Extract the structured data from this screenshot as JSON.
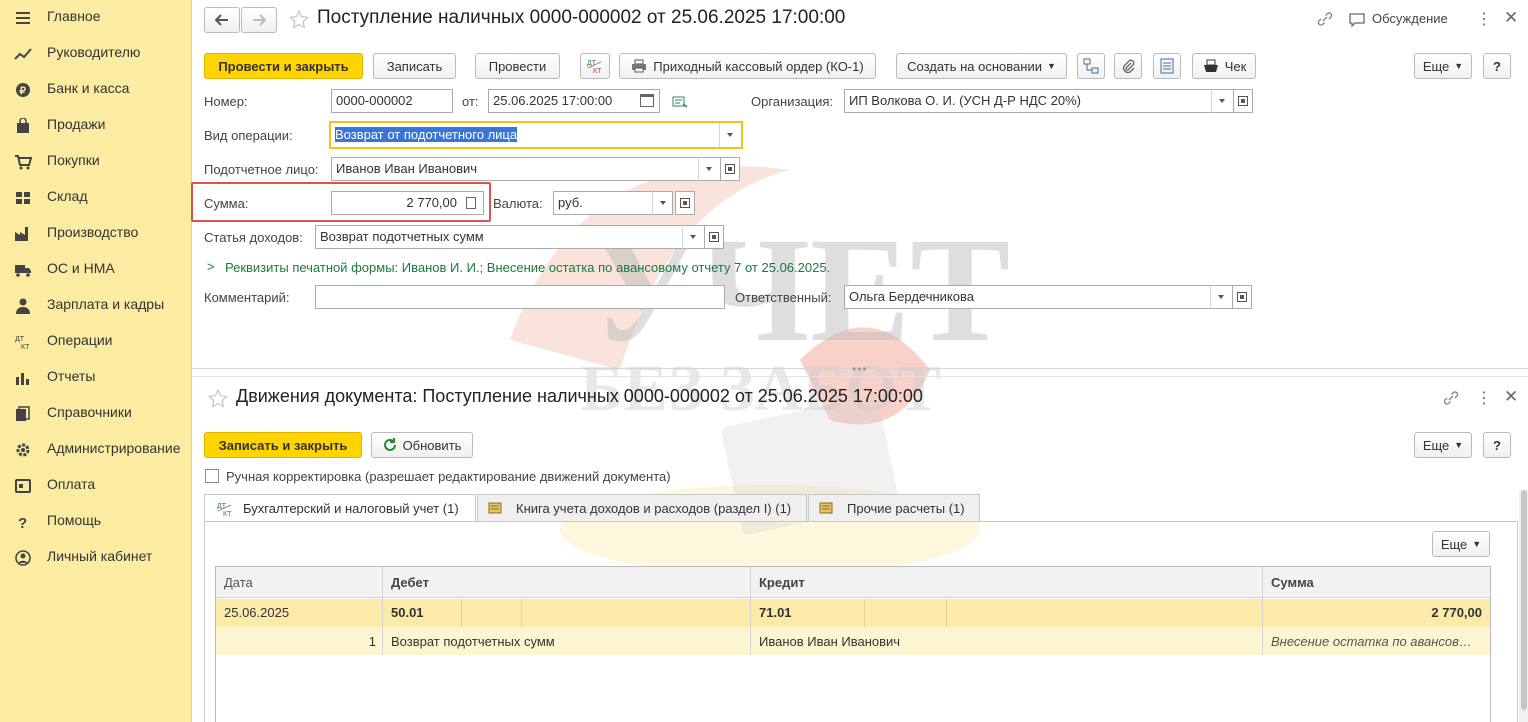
{
  "sidebar": {
    "items": [
      {
        "label": "Главное",
        "icon": "menu-icon"
      },
      {
        "label": "Руководителю",
        "icon": "trend-icon"
      },
      {
        "label": "Банк и касса",
        "icon": "coin-icon"
      },
      {
        "label": "Продажи",
        "icon": "bag-icon"
      },
      {
        "label": "Покупки",
        "icon": "cart-icon"
      },
      {
        "label": "Склад",
        "icon": "warehouse-icon"
      },
      {
        "label": "Производство",
        "icon": "factory-icon"
      },
      {
        "label": "ОС и НМА",
        "icon": "truck-icon"
      },
      {
        "label": "Зарплата и кадры",
        "icon": "person-icon"
      },
      {
        "label": "Операции",
        "icon": "dt-kt-icon"
      },
      {
        "label": "Отчеты",
        "icon": "bar-chart-icon"
      },
      {
        "label": "Справочники",
        "icon": "books-icon"
      },
      {
        "label": "Администрирование",
        "icon": "gear-icon"
      },
      {
        "label": "Оплата",
        "icon": "payment-icon"
      },
      {
        "label": "Помощь",
        "icon": "question-icon"
      },
      {
        "label": "Личный кабинет",
        "icon": "account-icon"
      }
    ]
  },
  "doc": {
    "title": "Поступление наличных 0000-000002 от 25.06.2025 17:00:00",
    "discussion": "Обсуждение",
    "buttons": {
      "post_close": "Провести и закрыть",
      "save": "Записать",
      "post": "Провести",
      "print_order": "Приходный кассовый ордер (КО-1)",
      "create_based": "Создать на основании",
      "check": "Чек",
      "more": "Еще",
      "help": "?"
    },
    "fields": {
      "number_label": "Номер:",
      "number": "0000-000002",
      "date_label": "от:",
      "date": "25.06.2025 17:00:00",
      "org_label": "Организация:",
      "org": "ИП Волкова О. И. (УСН Д-Р НДС 20%)",
      "op_label": "Вид операции:",
      "op": "Возврат от подотчетного лица",
      "person_label": "Подотчетное лицо:",
      "person": "Иванов Иван Иванович",
      "sum_label": "Сумма:",
      "sum": "2 770,00",
      "currency_label": "Валюта:",
      "currency": "руб.",
      "income_label": "Статья доходов:",
      "income": "Возврат подотчетных сумм",
      "print_requisites": "Реквизиты печатной формы: Иванов И. И.; Внесение остатка по авансовому отчету 7 от 25.06.2025.",
      "comment_label": "Комментарий:",
      "comment": "",
      "responsible_label": "Ответственный:",
      "responsible": "Ольга Бердечникова"
    }
  },
  "moves": {
    "title": "Движения документа: Поступление наличных 0000-000002 от 25.06.2025 17:00:00",
    "buttons": {
      "save_close": "Записать и закрыть",
      "refresh": "Обновить",
      "more": "Еще",
      "help": "?",
      "table_more": "Еще"
    },
    "manual_label": "Ручная корректировка (разрешает редактирование движений документа)",
    "tabs": [
      {
        "label": "Бухгалтерский и налоговый учет (1)"
      },
      {
        "label": "Книга учета доходов и расходов (раздел I) (1)"
      },
      {
        "label": "Прочие расчеты (1)"
      }
    ],
    "table": {
      "headers": [
        "Дата",
        "Дебет",
        "Кредит",
        "Сумма"
      ],
      "row1": {
        "date": "25.06.2025",
        "debit": "50.01",
        "credit": "71.01",
        "sum": "2 770,00"
      },
      "row2": {
        "num": "1",
        "debit": "Возврат подотчетных сумм",
        "credit": "Иванов Иван Иванович",
        "sum": "Внесение остатка по авансов…"
      }
    }
  },
  "watermark": {
    "line1": "УЧЕТ",
    "line2": "БЕЗ ЗАБОТ"
  },
  "colors": {
    "accent": "#ffd400",
    "sidebar": "#fbeca1",
    "highlight": "#d9534f",
    "link": "#1a7a3e"
  }
}
